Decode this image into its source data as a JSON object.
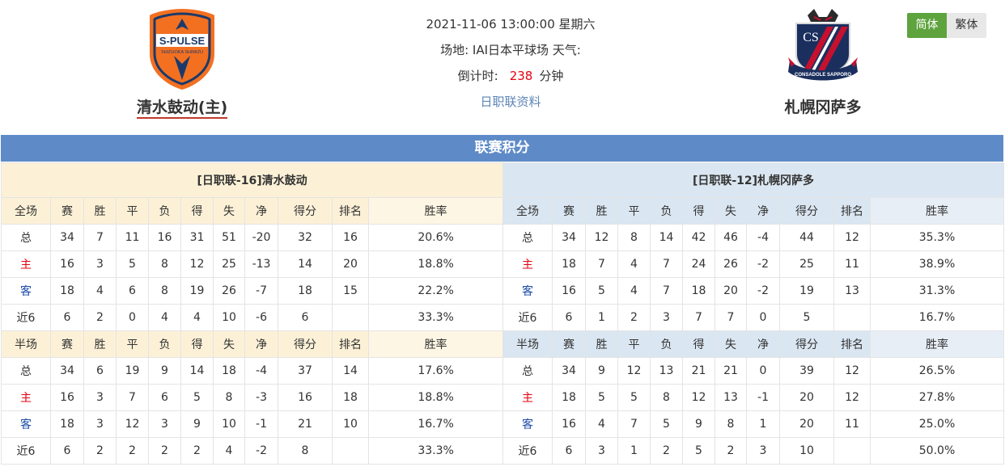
{
  "match": {
    "datetime": "2021-11-06 13:00:00 星期六",
    "venue_line": "场地: IAI日本平球场 天气:",
    "countdown_label": "倒计时:",
    "countdown_value": "238",
    "countdown_unit": "分钟",
    "league_link": "日职联资料"
  },
  "home": {
    "name": "清水鼓动(主)",
    "logo_text": "S-PULSE",
    "logo_subtext": "SHIZUOKA SHIMIZU",
    "logo_color": "#f37021",
    "table_title": "[日职联-16]清水鼓动"
  },
  "away": {
    "name": "札幌冈萨多",
    "logo_text": "CS",
    "logo_subtext": "CONSADOLE SAPPORO",
    "logo_color": "#c8102e",
    "table_title": "[日职联-12]札幌冈萨多"
  },
  "lang": {
    "simplified": "简体",
    "traditional": "繁体"
  },
  "standings_title": "联赛积分",
  "columns": [
    "赛",
    "胜",
    "平",
    "负",
    "得",
    "失",
    "净",
    "得分",
    "排名",
    "胜率"
  ],
  "periods": {
    "full": "全场",
    "half": "半场"
  },
  "home_full": [
    [
      "总",
      "34",
      "7",
      "11",
      "16",
      "31",
      "51",
      "-20",
      "32",
      "16",
      "20.6%"
    ],
    [
      "主",
      "16",
      "3",
      "5",
      "8",
      "12",
      "25",
      "-13",
      "14",
      "20",
      "18.8%"
    ],
    [
      "客",
      "18",
      "4",
      "6",
      "8",
      "19",
      "26",
      "-7",
      "18",
      "15",
      "22.2%"
    ],
    [
      "近6",
      "6",
      "2",
      "0",
      "4",
      "4",
      "10",
      "-6",
      "6",
      "",
      "33.3%"
    ]
  ],
  "home_half": [
    [
      "总",
      "34",
      "6",
      "19",
      "9",
      "14",
      "18",
      "-4",
      "37",
      "14",
      "17.6%"
    ],
    [
      "主",
      "16",
      "3",
      "7",
      "6",
      "5",
      "8",
      "-3",
      "16",
      "18",
      "18.8%"
    ],
    [
      "客",
      "18",
      "3",
      "12",
      "3",
      "9",
      "10",
      "-1",
      "21",
      "10",
      "16.7%"
    ],
    [
      "近6",
      "6",
      "2",
      "2",
      "2",
      "2",
      "4",
      "-2",
      "8",
      "",
      "33.3%"
    ]
  ],
  "away_full": [
    [
      "总",
      "34",
      "12",
      "8",
      "14",
      "42",
      "46",
      "-4",
      "44",
      "12",
      "35.3%"
    ],
    [
      "主",
      "18",
      "7",
      "4",
      "7",
      "24",
      "26",
      "-2",
      "25",
      "11",
      "38.9%"
    ],
    [
      "客",
      "16",
      "5",
      "4",
      "7",
      "18",
      "20",
      "-2",
      "19",
      "13",
      "31.3%"
    ],
    [
      "近6",
      "6",
      "1",
      "2",
      "3",
      "7",
      "7",
      "0",
      "5",
      "",
      "16.7%"
    ]
  ],
  "away_half": [
    [
      "总",
      "34",
      "9",
      "12",
      "13",
      "21",
      "21",
      "0",
      "39",
      "12",
      "26.5%"
    ],
    [
      "主",
      "18",
      "5",
      "5",
      "8",
      "12",
      "13",
      "-1",
      "20",
      "12",
      "27.8%"
    ],
    [
      "客",
      "16",
      "4",
      "7",
      "5",
      "9",
      "8",
      "1",
      "20",
      "11",
      "25.0%"
    ],
    [
      "近6",
      "6",
      "3",
      "1",
      "2",
      "5",
      "2",
      "3",
      "10",
      "",
      "50.0%"
    ]
  ]
}
